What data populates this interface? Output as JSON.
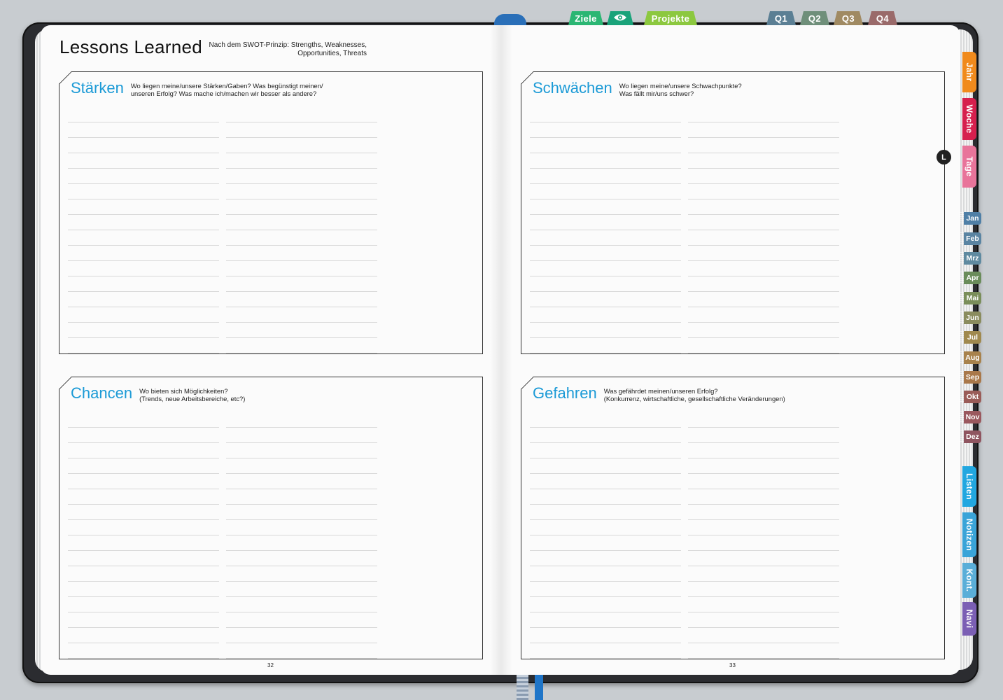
{
  "header": {
    "title": "Lessons Learned",
    "subtitle_lines": [
      "Nach dem SWOT-Prinzip: Strengths, Weaknesses,",
      "Opportunities, Threats"
    ]
  },
  "sections": [
    {
      "title": "Stärken",
      "question_lines": [
        "Wo liegen meine/unsere Stärken/Gaben? Was begünstigt meinen/",
        "unseren Erfolg? Was mache ich/machen wir besser als andere?"
      ]
    },
    {
      "title": "Schwächen",
      "question_lines": [
        "Wo liegen meine/unsere Schwachpunkte?",
        "Was fällt mir/uns schwer?"
      ]
    },
    {
      "title": "Chancen",
      "question_lines": [
        "Wo bieten sich Möglichkeiten?",
        "(Trends, neue Arbeitsbereiche, etc?)"
      ]
    },
    {
      "title": "Gefahren",
      "question_lines": [
        "Was gefährdet meinen/unseren Erfolg?",
        "(Konkurrenz, wirtschaftliche, gesellschaftliche Veränderungen)"
      ]
    }
  ],
  "page_numbers": {
    "left": "32",
    "right": "33"
  },
  "top_tabs": [
    {
      "label": "Ziele",
      "color": "#2bb673"
    },
    {
      "label": "eye-icon",
      "color": "#1aa37a"
    },
    {
      "label": "Projekte",
      "color": "#8cc83f"
    },
    {
      "label": "Q1",
      "color": "#5b7f94"
    },
    {
      "label": "Q2",
      "color": "#6f8f7a"
    },
    {
      "label": "Q3",
      "color": "#a08a62"
    },
    {
      "label": "Q4",
      "color": "#9a6a6a"
    }
  ],
  "side_tabs": [
    {
      "label": "Jahr",
      "color": "#f08a1c"
    },
    {
      "label": "Woche",
      "color": "#d6204e"
    },
    {
      "label": "Tage",
      "color": "#e8749a"
    }
  ],
  "month_tabs": [
    {
      "label": "Jan",
      "color": "#4f7fa6"
    },
    {
      "label": "Feb",
      "color": "#5a84a2"
    },
    {
      "label": "Mrz",
      "color": "#5f8aa0"
    },
    {
      "label": "Apr",
      "color": "#6a8c5a"
    },
    {
      "label": "Mai",
      "color": "#7a8e5a"
    },
    {
      "label": "Jun",
      "color": "#8a8c5e"
    },
    {
      "label": "Jul",
      "color": "#a0894e"
    },
    {
      "label": "Aug",
      "color": "#a8824c"
    },
    {
      "label": "Sep",
      "color": "#a9784a"
    },
    {
      "label": "Okt",
      "color": "#9a5c58"
    },
    {
      "label": "Nov",
      "color": "#9a585e"
    },
    {
      "label": "Dez",
      "color": "#8f5560"
    }
  ],
  "bottom_tabs": [
    {
      "label": "Listen",
      "color": "#22a7e0"
    },
    {
      "label": "Notizen",
      "color": "#3aa4d8"
    },
    {
      "label": "Kont.",
      "color": "#5aaed8"
    },
    {
      "label": "Navi",
      "color": "#7b5fb4"
    }
  ],
  "page_marker": "L"
}
